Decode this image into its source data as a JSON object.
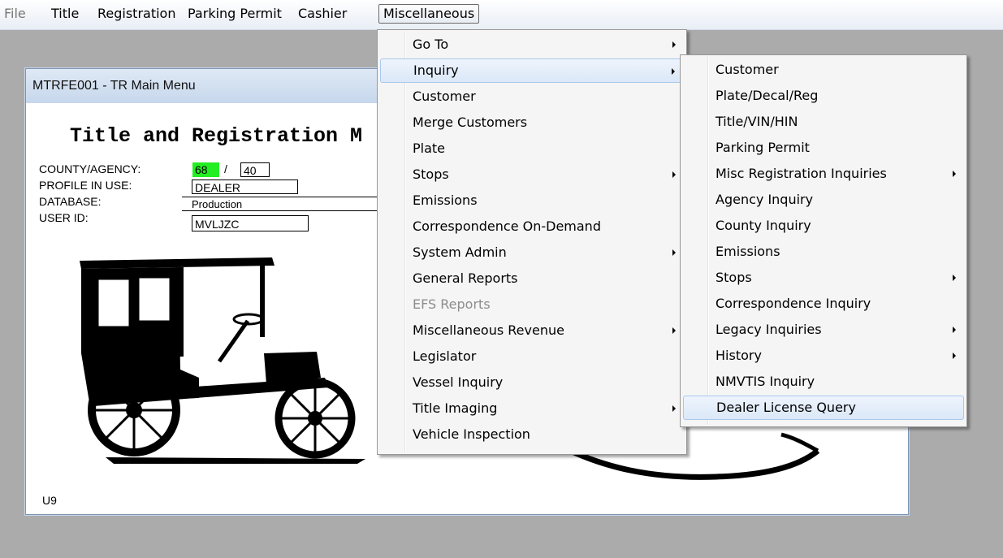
{
  "menubar": {
    "items": [
      "File",
      "Title",
      "Registration",
      "Parking Permit",
      "Cashier",
      "Miscellaneous"
    ]
  },
  "window": {
    "title": "MTRFE001 - TR Main Menu",
    "heading": "Title and Registration M",
    "fields": {
      "county_label": "COUNTY/AGENCY:",
      "county_value": "68",
      "slash": "/",
      "agency_value": "40",
      "profile_label": "PROFILE IN USE:",
      "profile_value": "DEALER",
      "database_label": "DATABASE:",
      "database_value": "Production",
      "userid_label": "USER ID:",
      "userid_value": "MVLJZC"
    },
    "status_text": "U9"
  },
  "misc_menu": {
    "items": [
      {
        "label": "Go To",
        "submenu": true
      },
      {
        "label": "Inquiry",
        "submenu": true,
        "highlighted": true
      },
      {
        "label": "Customer"
      },
      {
        "label": "Merge Customers"
      },
      {
        "label": "Plate"
      },
      {
        "label": "Stops",
        "submenu": true
      },
      {
        "label": "Emissions"
      },
      {
        "label": "Correspondence On-Demand"
      },
      {
        "label": "System Admin",
        "submenu": true
      },
      {
        "label": "General Reports"
      },
      {
        "label": "EFS Reports",
        "disabled": true
      },
      {
        "label": "Miscellaneous Revenue",
        "submenu": true
      },
      {
        "label": "Legislator"
      },
      {
        "label": "Vessel Inquiry"
      },
      {
        "label": "Title Imaging",
        "submenu": true
      },
      {
        "label": "Vehicle Inspection"
      }
    ]
  },
  "inquiry_menu": {
    "items": [
      {
        "label": "Customer"
      },
      {
        "label": "Plate/Decal/Reg"
      },
      {
        "label": "Title/VIN/HIN"
      },
      {
        "label": "Parking Permit"
      },
      {
        "label": "Misc Registration Inquiries",
        "submenu": true
      },
      {
        "label": "Agency Inquiry"
      },
      {
        "label": "County Inquiry"
      },
      {
        "label": "Emissions"
      },
      {
        "label": "Stops",
        "submenu": true
      },
      {
        "label": "Correspondence Inquiry"
      },
      {
        "label": "Legacy Inquiries",
        "submenu": true
      },
      {
        "label": "History",
        "submenu": true
      },
      {
        "label": "NMVTIS Inquiry"
      },
      {
        "label": "Dealer License Query",
        "highlighted": true
      }
    ]
  },
  "colors": {
    "desktop": "#ababab",
    "highlight_border": "#a8c8ec",
    "county_field": "#22ee22"
  }
}
